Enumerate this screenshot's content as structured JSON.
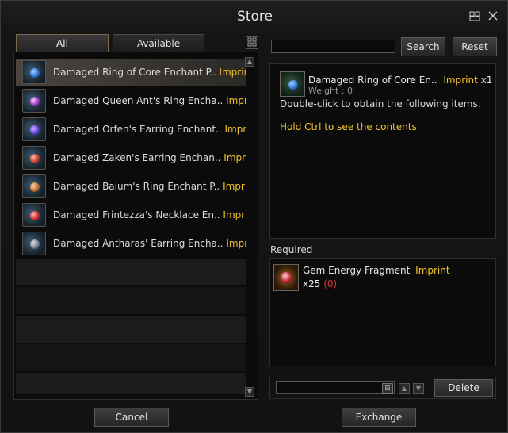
{
  "window": {
    "title": "Store"
  },
  "title_icons": [
    "inventory-icon",
    "close-icon"
  ],
  "tabs": [
    {
      "label": "All",
      "active": true
    },
    {
      "label": "Available",
      "active": false
    }
  ],
  "list": {
    "items": [
      {
        "name": "Damaged Ring of Core Enchant P..",
        "tag": "Imprint",
        "icon": "ring-core-icon",
        "selected": true
      },
      {
        "name": "Damaged Queen Ant's Ring Encha..",
        "tag": "Imprint",
        "icon": "ring-queen-ant-icon"
      },
      {
        "name": "Damaged Orfen's Earring Enchant..",
        "tag": "Imprint",
        "icon": "earring-orfen-icon"
      },
      {
        "name": "Damaged Zaken's Earring Enchan..",
        "tag": "Imprint(",
        "icon": "earring-zaken-icon"
      },
      {
        "name": "Damaged Baium's Ring Enchant P..",
        "tag": "Imprint(",
        "icon": "ring-baium-icon"
      },
      {
        "name": "Damaged Frintezza's Necklace En..",
        "tag": "Imprint(",
        "icon": "necklace-frintezza-icon"
      },
      {
        "name": "Damaged Antharas' Earring Encha..",
        "tag": "Imprint",
        "icon": "earring-antharas-icon"
      }
    ]
  },
  "search": {
    "value": "",
    "button": "Search",
    "reset": "Reset"
  },
  "detail": {
    "name": "Damaged Ring of Core En..",
    "tag": "Imprint",
    "count": "x1",
    "weight": "Weight : 0",
    "description": "Double-click to obtain the following items.",
    "hint": "Hold Ctrl to see the contents"
  },
  "required": {
    "label": "Required",
    "item": {
      "name": "Gem Energy Fragment",
      "tag": "Imprint",
      "qty": "x25",
      "owned": "(0)"
    }
  },
  "footer": {
    "delete": "Delete",
    "cancel": "Cancel",
    "exchange": "Exchange"
  },
  "colors": {
    "accent": "#f2c22e",
    "missing": "#e03030"
  }
}
